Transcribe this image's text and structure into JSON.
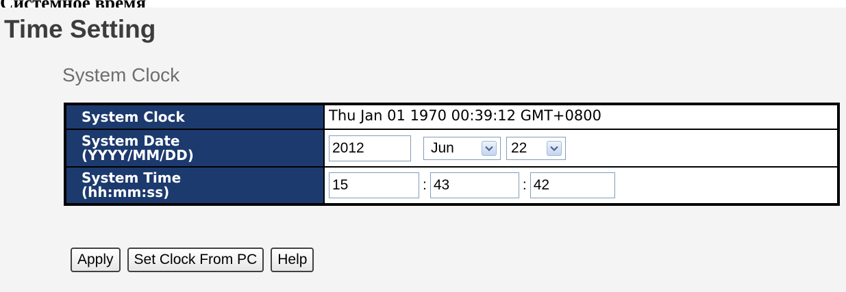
{
  "document_caption": "Системное время",
  "page_title": "Time Setting",
  "section_title": "System Clock",
  "rows": {
    "clock": {
      "label": "System Clock",
      "value": "Thu Jan 01 1970 00:39:12 GMT+0800"
    },
    "date": {
      "label_line1": "System Date",
      "label_line2": "(YYYY/MM/DD)",
      "year": "2012",
      "month": "Jun",
      "day": "22"
    },
    "time": {
      "label_line1": "System Time",
      "label_line2": "(hh:mm:ss)",
      "hour": "15",
      "minute": "43",
      "second": "42",
      "separator": ":"
    }
  },
  "buttons": {
    "apply": "Apply",
    "set_clock_from_pc": "Set Clock From PC",
    "help": "Help"
  },
  "icons": {
    "dropdown": "chevron-down-icon"
  },
  "colors": {
    "label_background": "#1c3a6e",
    "label_text": "#ffffff",
    "panel_background": "#f4f4f4",
    "page_title": "#3c3c3c",
    "section_title": "#6e6e6e",
    "input_border": "#7f9db9",
    "dropdown_arrow": "#4d6185"
  }
}
